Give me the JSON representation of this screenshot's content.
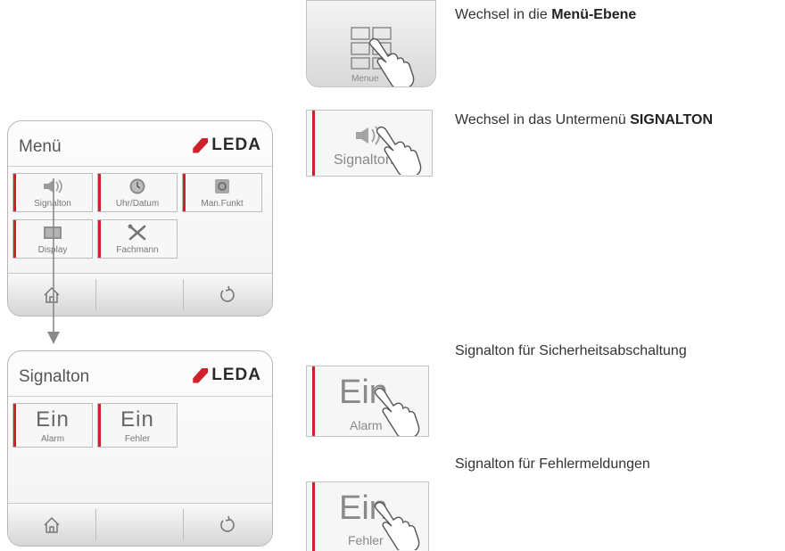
{
  "menu_screen": {
    "title": "Menü",
    "brand": "LEDA",
    "tiles": [
      {
        "label": "Signalton",
        "icon": "speaker-icon"
      },
      {
        "label": "Uhr/Datum",
        "icon": "clock-icon"
      },
      {
        "label": "Man.Funkt",
        "icon": "manual-function-icon"
      },
      {
        "label": "Display",
        "icon": "display-icon"
      },
      {
        "label": "Fachmann",
        "icon": "tools-icon"
      }
    ],
    "bottom_bar": {
      "left_icon": "home-icon",
      "right_icon": "back-icon"
    }
  },
  "signal_screen": {
    "title": "Signalton",
    "brand": "LEDA",
    "tiles": [
      {
        "value": "Ein",
        "label": "Alarm"
      },
      {
        "value": "Ein",
        "label": "Fehler"
      }
    ],
    "bottom_bar": {
      "left_icon": "home-icon",
      "right_icon": "back-icon"
    }
  },
  "zoom_buttons": {
    "menue": {
      "label": "Menue",
      "icon": "menu-grid-icon"
    },
    "signalton": {
      "label": "Signalton",
      "icon": "speaker-icon"
    },
    "alarm": {
      "value": "Ein",
      "label": "Alarm"
    },
    "fehler": {
      "value": "Ein",
      "label": "Fehler"
    }
  },
  "notes": {
    "menu_prefix": "Wechsel in die ",
    "menu_bold": "Menü-Ebene",
    "signal_prefix": "Wechsel in das Untermenü ",
    "signal_bold": "SIGNALTON",
    "alarm": "Signalton für Sicherheitsabschaltung",
    "fehler": "Signalton für Fehlermeldungen"
  },
  "colors": {
    "accent_red": "#d0202a",
    "frame_grey": "#b7b7b7"
  }
}
